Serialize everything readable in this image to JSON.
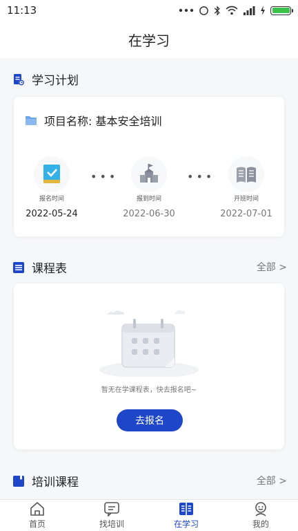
{
  "status_bar": {
    "time": "11:13"
  },
  "header": {
    "title": "在学习"
  },
  "study_plan": {
    "title": "学习计划",
    "project_label": "项目名称: 基本安全培训",
    "steps": [
      {
        "icon": "signup-book-icon",
        "label": "报名时间",
        "date": "2022-05-24"
      },
      {
        "icon": "school-building-icon",
        "label": "报到时间",
        "date": "2022-06-30"
      },
      {
        "icon": "open-book-icon",
        "label": "开班时间",
        "date": "2022-07-01"
      }
    ]
  },
  "schedule": {
    "title": "课程表",
    "more": "全部 >",
    "empty_text": "暂无在学课程表，快去报名吧~",
    "button": "去报名"
  },
  "training": {
    "title": "培训课程",
    "more": "全部 >"
  },
  "tabbar": {
    "tabs": [
      {
        "label": "首页",
        "icon": "home-icon"
      },
      {
        "label": "找培训",
        "icon": "message-icon"
      },
      {
        "label": "在学习",
        "icon": "book-icon"
      },
      {
        "label": "我的",
        "icon": "profile-icon"
      }
    ],
    "active_index": 2
  },
  "colors": {
    "accent": "#1d46c9",
    "background": "#f6f7f9",
    "battery": "#3cc24a"
  }
}
